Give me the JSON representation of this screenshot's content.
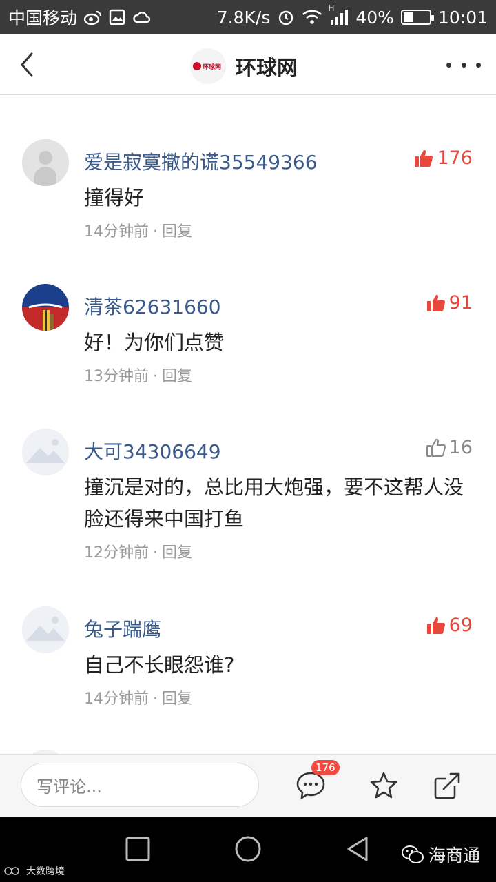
{
  "status_bar": {
    "carrier": "中国移动",
    "speed": "7.8K/s",
    "signal_label": "H",
    "battery": "40%",
    "battery_level": 0.4,
    "time": "10:01"
  },
  "header": {
    "title": "环球网",
    "logo_text": "环球网"
  },
  "comments": [
    {
      "username": "爱是寂寞撒的谎35549366",
      "text": "撞得好",
      "time": "14分钟前",
      "reply": "回复",
      "likes": "176",
      "liked": true,
      "avatar": "default-gray"
    },
    {
      "username": "清茶62631660",
      "text": "好！为你们点赞",
      "time": "13分钟前",
      "reply": "回复",
      "likes": "91",
      "liked": true,
      "avatar": "photo-flag"
    },
    {
      "username": "大可34306649",
      "text": "撞沉是对的，总比用大炮强，要不这帮人没脸还得来中国打鱼",
      "time": "12分钟前",
      "reply": "回复",
      "likes": "16",
      "liked": false,
      "avatar": "mountain-placeholder"
    },
    {
      "username": "兔子踹鹰",
      "text": "自己不长眼怨谁?",
      "time": "14分钟前",
      "reply": "回复",
      "likes": "69",
      "liked": true,
      "avatar": "mountain-placeholder"
    }
  ],
  "bottom_bar": {
    "input_placeholder": "写评论...",
    "comment_count": "176"
  },
  "watermarks": {
    "left": "大数跨境",
    "right": "海商通"
  },
  "colors": {
    "accent_red": "#e8473b",
    "username_blue": "#3a5a8c",
    "status_bar": "#3a3a3a"
  }
}
